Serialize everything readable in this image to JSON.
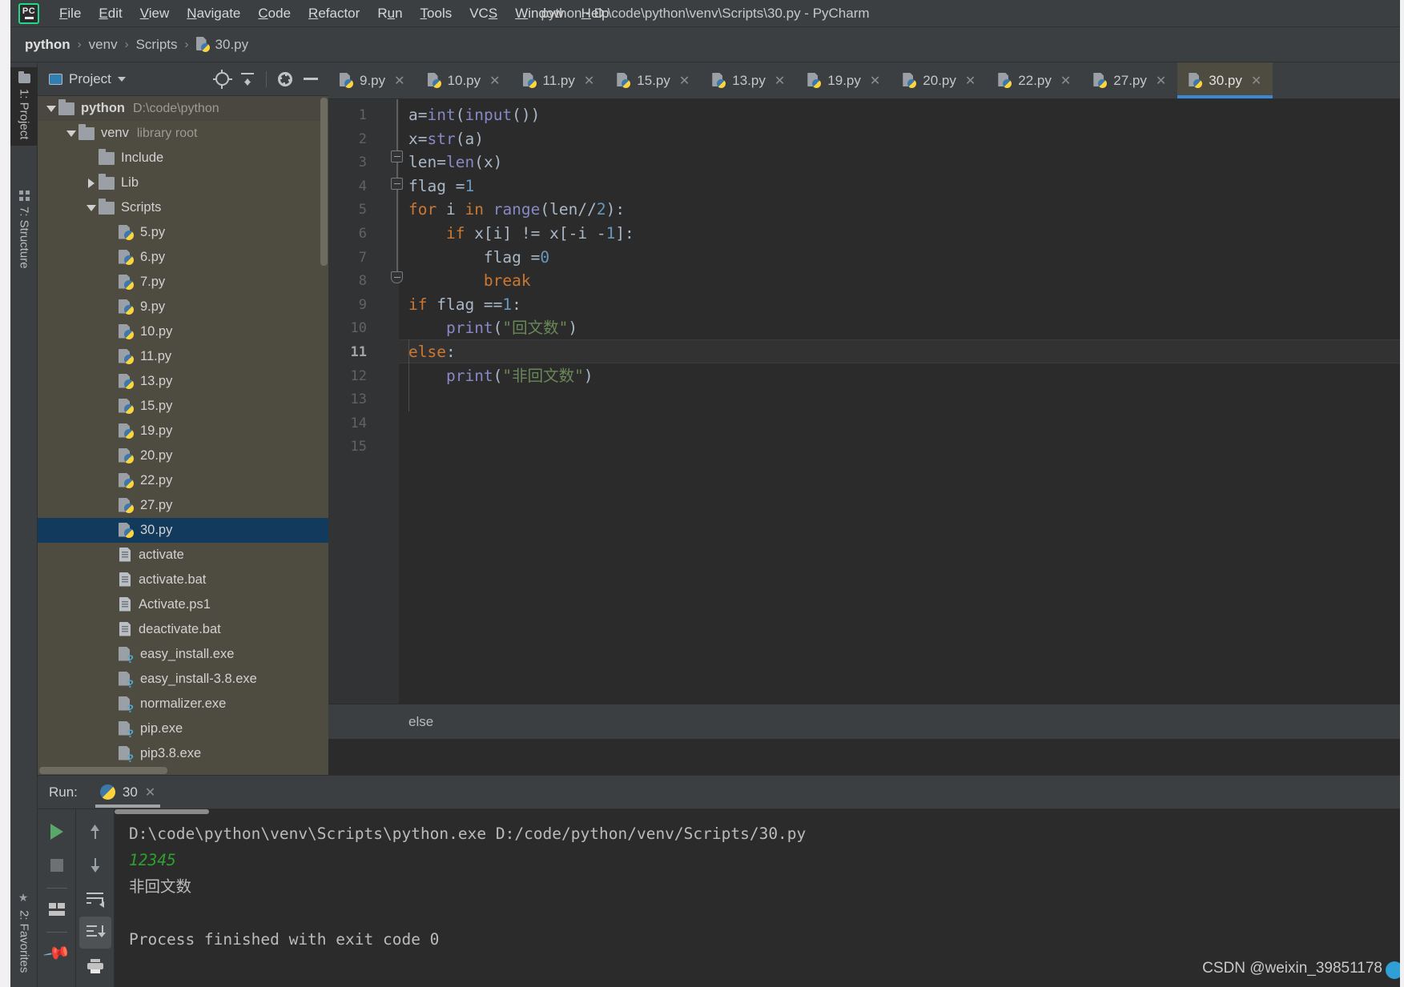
{
  "window": {
    "title": "python - D:\\code\\python\\venv\\Scripts\\30.py - PyCharm",
    "logo_text": "PC"
  },
  "menubar": {
    "items": [
      {
        "label": "File",
        "mnemonic": "F"
      },
      {
        "label": "Edit",
        "mnemonic": "E"
      },
      {
        "label": "View",
        "mnemonic": "V"
      },
      {
        "label": "Navigate",
        "mnemonic": "N"
      },
      {
        "label": "Code",
        "mnemonic": "C"
      },
      {
        "label": "Refactor",
        "mnemonic": "R"
      },
      {
        "label": "Run",
        "mnemonic": "u"
      },
      {
        "label": "Tools",
        "mnemonic": "T"
      },
      {
        "label": "VCS",
        "mnemonic": "S"
      },
      {
        "label": "Window",
        "mnemonic": "W"
      },
      {
        "label": "Help",
        "mnemonic": "H"
      }
    ]
  },
  "breadcrumb_nav": {
    "items": [
      "python",
      "venv",
      "Scripts",
      "30.py"
    ],
    "separator": "›"
  },
  "left_stripe": {
    "tabs": [
      {
        "label": "1: Project",
        "icon": "folder-icon",
        "active": true
      },
      {
        "label": "7: Structure",
        "icon": "structure-icon",
        "active": false
      },
      {
        "label": "2: Favorites",
        "icon": "star-icon",
        "active": false
      }
    ]
  },
  "project_panel": {
    "title": "Project",
    "toolbar": [
      {
        "name": "locate-icon",
        "tooltip": "Select Opened File"
      },
      {
        "name": "collapse-all-icon",
        "tooltip": "Collapse All"
      },
      {
        "name": "gear-icon",
        "tooltip": "Settings"
      },
      {
        "name": "minimize-icon",
        "tooltip": "Hide"
      }
    ],
    "tree": [
      {
        "label": "python",
        "sub": "D:\\code\\python",
        "icon": "folder-icon",
        "arrow": "down",
        "depth": 0,
        "bold": true,
        "selected": false
      },
      {
        "label": "venv",
        "sub": "library root",
        "icon": "folder-icon",
        "arrow": "down",
        "depth": 1,
        "bold": false,
        "selected": false
      },
      {
        "label": "Include",
        "sub": "",
        "icon": "folder-icon",
        "arrow": "none",
        "depth": 2,
        "bold": false,
        "selected": false
      },
      {
        "label": "Lib",
        "sub": "",
        "icon": "folder-icon",
        "arrow": "right",
        "depth": 2,
        "bold": false,
        "selected": false
      },
      {
        "label": "Scripts",
        "sub": "",
        "icon": "folder-icon",
        "arrow": "down",
        "depth": 2,
        "bold": false,
        "selected": false
      },
      {
        "label": "5.py",
        "sub": "",
        "icon": "python-file-icon",
        "arrow": "none",
        "depth": 3,
        "bold": false,
        "selected": false
      },
      {
        "label": "6.py",
        "sub": "",
        "icon": "python-file-icon",
        "arrow": "none",
        "depth": 3,
        "bold": false,
        "selected": false
      },
      {
        "label": "7.py",
        "sub": "",
        "icon": "python-file-icon",
        "arrow": "none",
        "depth": 3,
        "bold": false,
        "selected": false
      },
      {
        "label": "9.py",
        "sub": "",
        "icon": "python-file-icon",
        "arrow": "none",
        "depth": 3,
        "bold": false,
        "selected": false
      },
      {
        "label": "10.py",
        "sub": "",
        "icon": "python-file-icon",
        "arrow": "none",
        "depth": 3,
        "bold": false,
        "selected": false
      },
      {
        "label": "11.py",
        "sub": "",
        "icon": "python-file-icon",
        "arrow": "none",
        "depth": 3,
        "bold": false,
        "selected": false
      },
      {
        "label": "13.py",
        "sub": "",
        "icon": "python-file-icon",
        "arrow": "none",
        "depth": 3,
        "bold": false,
        "selected": false
      },
      {
        "label": "15.py",
        "sub": "",
        "icon": "python-file-icon",
        "arrow": "none",
        "depth": 3,
        "bold": false,
        "selected": false
      },
      {
        "label": "19.py",
        "sub": "",
        "icon": "python-file-icon",
        "arrow": "none",
        "depth": 3,
        "bold": false,
        "selected": false
      },
      {
        "label": "20.py",
        "sub": "",
        "icon": "python-file-icon",
        "arrow": "none",
        "depth": 3,
        "bold": false,
        "selected": false
      },
      {
        "label": "22.py",
        "sub": "",
        "icon": "python-file-icon",
        "arrow": "none",
        "depth": 3,
        "bold": false,
        "selected": false
      },
      {
        "label": "27.py",
        "sub": "",
        "icon": "python-file-icon",
        "arrow": "none",
        "depth": 3,
        "bold": false,
        "selected": false
      },
      {
        "label": "30.py",
        "sub": "",
        "icon": "python-file-icon",
        "arrow": "none",
        "depth": 3,
        "bold": false,
        "selected": true
      },
      {
        "label": "activate",
        "sub": "",
        "icon": "text-file-icon",
        "arrow": "none",
        "depth": 3,
        "bold": false,
        "selected": false
      },
      {
        "label": "activate.bat",
        "sub": "",
        "icon": "text-file-icon",
        "arrow": "none",
        "depth": 3,
        "bold": false,
        "selected": false
      },
      {
        "label": "Activate.ps1",
        "sub": "",
        "icon": "text-file-icon",
        "arrow": "none",
        "depth": 3,
        "bold": false,
        "selected": false
      },
      {
        "label": "deactivate.bat",
        "sub": "",
        "icon": "text-file-icon",
        "arrow": "none",
        "depth": 3,
        "bold": false,
        "selected": false
      },
      {
        "label": "easy_install.exe",
        "sub": "",
        "icon": "unknown-file-icon",
        "arrow": "none",
        "depth": 3,
        "bold": false,
        "selected": false
      },
      {
        "label": "easy_install-3.8.exe",
        "sub": "",
        "icon": "unknown-file-icon",
        "arrow": "none",
        "depth": 3,
        "bold": false,
        "selected": false
      },
      {
        "label": "normalizer.exe",
        "sub": "",
        "icon": "unknown-file-icon",
        "arrow": "none",
        "depth": 3,
        "bold": false,
        "selected": false
      },
      {
        "label": "pip.exe",
        "sub": "",
        "icon": "unknown-file-icon",
        "arrow": "none",
        "depth": 3,
        "bold": false,
        "selected": false
      },
      {
        "label": "pip3.8.exe",
        "sub": "",
        "icon": "unknown-file-icon",
        "arrow": "none",
        "depth": 3,
        "bold": false,
        "selected": false
      }
    ]
  },
  "editor": {
    "tabs": [
      {
        "label": "9.py",
        "active": false
      },
      {
        "label": "10.py",
        "active": false
      },
      {
        "label": "11.py",
        "active": false
      },
      {
        "label": "15.py",
        "active": false
      },
      {
        "label": "13.py",
        "active": false
      },
      {
        "label": "19.py",
        "active": false
      },
      {
        "label": "20.py",
        "active": false
      },
      {
        "label": "22.py",
        "active": false
      },
      {
        "label": "27.py",
        "active": false
      },
      {
        "label": "30.py",
        "active": true
      }
    ],
    "close_glyph": "✕",
    "current_line": 11,
    "line_numbers": [
      1,
      2,
      3,
      4,
      5,
      6,
      7,
      8,
      9,
      10,
      11,
      12,
      13,
      14,
      15
    ],
    "code_lines": [
      {
        "n": 1,
        "tokens": [
          {
            "t": "a=",
            "c": "p"
          },
          {
            "t": "int",
            "c": "b"
          },
          {
            "t": "(",
            "c": "p"
          },
          {
            "t": "input",
            "c": "b"
          },
          {
            "t": "())",
            "c": "p"
          }
        ]
      },
      {
        "n": 2,
        "tokens": [
          {
            "t": "x=",
            "c": "p"
          },
          {
            "t": "str",
            "c": "b"
          },
          {
            "t": "(a)",
            "c": "p"
          }
        ]
      },
      {
        "n": 3,
        "tokens": [
          {
            "t": "len=",
            "c": "p"
          },
          {
            "t": "len",
            "c": "b"
          },
          {
            "t": "(x)",
            "c": "p"
          }
        ]
      },
      {
        "n": 4,
        "tokens": [
          {
            "t": "flag =",
            "c": "p"
          },
          {
            "t": "1",
            "c": "n"
          }
        ]
      },
      {
        "n": 5,
        "tokens": [
          {
            "t": "for",
            "c": "k"
          },
          {
            "t": " i ",
            "c": "p"
          },
          {
            "t": "in",
            "c": "k"
          },
          {
            "t": " ",
            "c": "p"
          },
          {
            "t": "range",
            "c": "b"
          },
          {
            "t": "(len//",
            "c": "p"
          },
          {
            "t": "2",
            "c": "n"
          },
          {
            "t": "):",
            "c": "p"
          }
        ]
      },
      {
        "n": 6,
        "tokens": [
          {
            "t": "    ",
            "c": "p"
          },
          {
            "t": "if",
            "c": "k"
          },
          {
            "t": " x[i] != x[-i -",
            "c": "p"
          },
          {
            "t": "1",
            "c": "n"
          },
          {
            "t": "]:",
            "c": "p"
          }
        ]
      },
      {
        "n": 7,
        "tokens": [
          {
            "t": "        flag =",
            "c": "p"
          },
          {
            "t": "0",
            "c": "n"
          }
        ]
      },
      {
        "n": 8,
        "tokens": [
          {
            "t": "        ",
            "c": "p"
          },
          {
            "t": "break",
            "c": "k"
          }
        ]
      },
      {
        "n": 9,
        "tokens": [
          {
            "t": "if",
            "c": "k"
          },
          {
            "t": " flag ==",
            "c": "p"
          },
          {
            "t": "1",
            "c": "n"
          },
          {
            "t": ":",
            "c": "p"
          }
        ]
      },
      {
        "n": 10,
        "tokens": [
          {
            "t": "    ",
            "c": "p"
          },
          {
            "t": "print",
            "c": "b"
          },
          {
            "t": "(",
            "c": "p"
          },
          {
            "t": "\"回文数\"",
            "c": "s"
          },
          {
            "t": ")",
            "c": "p"
          }
        ]
      },
      {
        "n": 11,
        "tokens": [
          {
            "t": "else",
            "c": "k"
          },
          {
            "t": ":",
            "c": "p"
          }
        ]
      },
      {
        "n": 12,
        "tokens": [
          {
            "t": "    ",
            "c": "p"
          },
          {
            "t": "print",
            "c": "b"
          },
          {
            "t": "(",
            "c": "p"
          },
          {
            "t": "\"非回文数\"",
            "c": "s"
          },
          {
            "t": ")",
            "c": "p"
          }
        ]
      },
      {
        "n": 13,
        "tokens": []
      },
      {
        "n": 14,
        "tokens": []
      },
      {
        "n": 15,
        "tokens": []
      }
    ],
    "code_plain": [
      "a=int(input())",
      "x=str(a)",
      "len=len(x)",
      "flag =1",
      "for i in range(len//2):",
      "    if x[i] != x[-i -1]:",
      "        flag =0",
      "        break",
      "if flag ==1:",
      "    print(\"回文数\")",
      "else:",
      "    print(\"非回文数\")",
      "",
      "",
      ""
    ],
    "breadcrumb": "else"
  },
  "run_panel": {
    "label": "Run:",
    "tab_label": "30",
    "close_glyph": "✕",
    "toolbar_left": [
      {
        "name": "rerun-icon",
        "tooltip": "Rerun",
        "selected": false
      },
      {
        "name": "stop-icon",
        "tooltip": "Stop",
        "selected": false
      },
      {
        "name": "layout-icon",
        "tooltip": "Restore Layout",
        "selected": false
      },
      {
        "name": "pin-icon",
        "tooltip": "Pin Tab",
        "selected": false
      }
    ],
    "toolbar_right": [
      {
        "name": "arrow-up-icon",
        "tooltip": "Up the Stack Trace",
        "selected": false
      },
      {
        "name": "arrow-down-icon",
        "tooltip": "Down the Stack Trace",
        "selected": false
      },
      {
        "name": "soft-wrap-icon",
        "tooltip": "Use Soft Wraps",
        "selected": false
      },
      {
        "name": "scroll-to-end-icon",
        "tooltip": "Scroll to the End",
        "selected": true
      },
      {
        "name": "print-icon",
        "tooltip": "Print",
        "selected": false
      }
    ],
    "console_lines": [
      {
        "text": "D:\\code\\python\\venv\\Scripts\\python.exe D:/code/python/venv/Scripts/30.py",
        "style": "normal"
      },
      {
        "text": "12345",
        "style": "input"
      },
      {
        "text": "非回文数",
        "style": "normal"
      },
      {
        "text": "",
        "style": "normal"
      },
      {
        "text": "Process finished with exit code 0",
        "style": "normal"
      }
    ]
  },
  "watermark": {
    "text": "CSDN @weixin_39851178"
  },
  "colors": {
    "accent_blue": "#3d87d8",
    "selection_blue": "#113a5c",
    "tree_background": "#4e4b41",
    "editor_background": "#2b2b2b",
    "panel_background": "#3c3f41",
    "keyword_orange": "#cc7832",
    "builtin_purple": "#8888c6",
    "number_blue": "#6897bb",
    "string_green": "#6a8759",
    "console_input_green": "#2ea02e",
    "logo_green": "#21d789"
  }
}
